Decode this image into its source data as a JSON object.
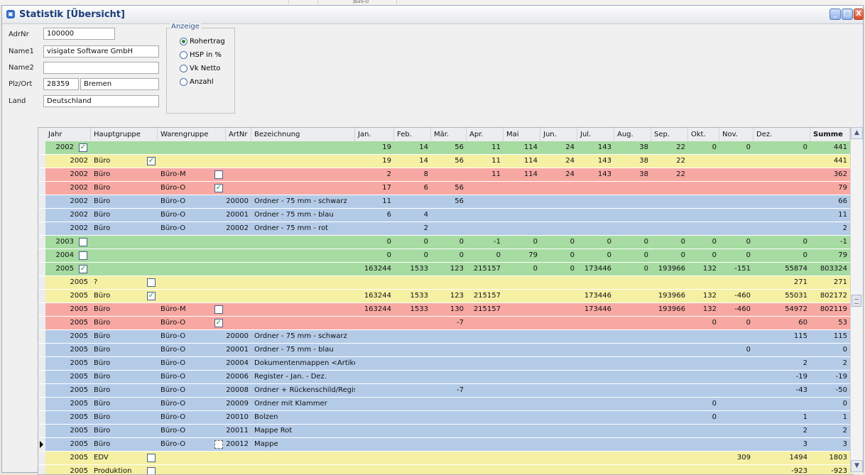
{
  "background": {
    "cell_text": "Büro-O"
  },
  "window": {
    "title": "Statistik [Übersicht]",
    "minimize": "_",
    "maximize": "□",
    "close": "X"
  },
  "form": {
    "adrnr_label": "AdrNr",
    "adrnr": "100000",
    "name1_label": "Name1",
    "name1": "visigate Software GmbH",
    "name2_label": "Name2",
    "name2": "",
    "plzort_label": "Plz/Ort",
    "plz": "28359",
    "ort": "Bremen",
    "land_label": "Land",
    "land": "Deutschland"
  },
  "anzeige": {
    "label": "Anzeige",
    "options": [
      "Rohertrag",
      "HSP in %",
      "Vk Netto",
      "Anzahl"
    ],
    "selected": 0
  },
  "colors": {
    "green": "#a6dba1",
    "yellow": "#f5f0a3",
    "red": "#f7a8a3",
    "blue": "#b4cbe8"
  },
  "table": {
    "headers": [
      "Jahr",
      "Hauptgruppe",
      "Warengruppe",
      "ArtNr",
      "Bezeichnung",
      "Jan.",
      "Feb.",
      "Mär.",
      "Apr.",
      "Mai",
      "Jun.",
      "Jul.",
      "Aug.",
      "Sep.",
      "Okt.",
      "Nov.",
      "Dez.",
      "Summe"
    ],
    "rows": [
      {
        "color": "green",
        "jahr": "2002",
        "jcb": "checked",
        "hg": "",
        "hcb": "none",
        "wg": "",
        "wcb": "none",
        "artnr": "",
        "bez": "",
        "m": [
          "19",
          "14",
          "56",
          "11",
          "114",
          "24",
          "143",
          "38",
          "22",
          "0",
          "0",
          "0"
        ],
        "summe": "441"
      },
      {
        "color": "yellow",
        "jahr": "2002",
        "jcb": "none",
        "hg": "Büro",
        "hcb": "checked",
        "wg": "",
        "wcb": "none",
        "artnr": "",
        "bez": "",
        "m": [
          "19",
          "14",
          "56",
          "11",
          "114",
          "24",
          "143",
          "38",
          "22",
          "",
          "",
          ""
        ],
        "summe": "441"
      },
      {
        "color": "red",
        "jahr": "2002",
        "jcb": "none",
        "hg": "Büro",
        "hcb": "none",
        "wg": "Büro-M",
        "wcb": "empty",
        "artnr": "",
        "bez": "",
        "m": [
          "2",
          "8",
          "",
          "11",
          "114",
          "24",
          "143",
          "38",
          "22",
          "",
          "",
          ""
        ],
        "summe": "362"
      },
      {
        "color": "red",
        "jahr": "2002",
        "jcb": "none",
        "hg": "Büro",
        "hcb": "none",
        "wg": "Büro-O",
        "wcb": "checked",
        "artnr": "",
        "bez": "",
        "m": [
          "17",
          "6",
          "56",
          "",
          "",
          "",
          "",
          "",
          "",
          "",
          "",
          ""
        ],
        "summe": "79"
      },
      {
        "color": "blue",
        "jahr": "2002",
        "jcb": "none",
        "hg": "Büro",
        "hcb": "none",
        "wg": "Büro-O",
        "wcb": "none",
        "artnr": "20000",
        "bez": "Ordner - 75 mm - schwarz",
        "m": [
          "11",
          "",
          "56",
          "",
          "",
          "",
          "",
          "",
          "",
          "",
          "",
          ""
        ],
        "summe": "66"
      },
      {
        "color": "blue",
        "jahr": "2002",
        "jcb": "none",
        "hg": "Büro",
        "hcb": "none",
        "wg": "Büro-O",
        "wcb": "none",
        "artnr": "20001",
        "bez": "Ordner - 75 mm - blau",
        "m": [
          "6",
          "4",
          "",
          "",
          "",
          "",
          "",
          "",
          "",
          "",
          "",
          ""
        ],
        "summe": "11"
      },
      {
        "color": "blue",
        "jahr": "2002",
        "jcb": "none",
        "hg": "Büro",
        "hcb": "none",
        "wg": "Büro-O",
        "wcb": "none",
        "artnr": "20002",
        "bez": "Ordner - 75 mm - rot",
        "m": [
          "",
          "2",
          "",
          "",
          "",
          "",
          "",
          "",
          "",
          "",
          "",
          ""
        ],
        "summe": "2"
      },
      {
        "color": "green",
        "jahr": "2003",
        "jcb": "empty",
        "hg": "",
        "hcb": "none",
        "wg": "",
        "wcb": "none",
        "artnr": "",
        "bez": "",
        "m": [
          "0",
          "0",
          "0",
          "-1",
          "0",
          "0",
          "0",
          "0",
          "0",
          "0",
          "0",
          "0"
        ],
        "summe": "-1"
      },
      {
        "color": "green",
        "jahr": "2004",
        "jcb": "empty",
        "hg": "",
        "hcb": "none",
        "wg": "",
        "wcb": "none",
        "artnr": "",
        "bez": "",
        "m": [
          "0",
          "0",
          "0",
          "0",
          "79",
          "0",
          "0",
          "0",
          "0",
          "0",
          "0",
          "0"
        ],
        "summe": "79"
      },
      {
        "color": "green",
        "jahr": "2005",
        "jcb": "checked",
        "hg": "",
        "hcb": "none",
        "wg": "",
        "wcb": "none",
        "artnr": "",
        "bez": "",
        "m": [
          "163244",
          "1533",
          "123",
          "215157",
          "0",
          "0",
          "173446",
          "0",
          "193966",
          "132",
          "-151",
          "55874"
        ],
        "summe": "803324"
      },
      {
        "color": "yellow",
        "jahr": "2005",
        "jcb": "none",
        "hg": "?",
        "hcb": "empty",
        "wg": "",
        "wcb": "none",
        "artnr": "",
        "bez": "",
        "m": [
          "",
          "",
          "",
          "",
          "",
          "",
          "",
          "",
          "",
          "",
          "",
          "271"
        ],
        "summe": "271"
      },
      {
        "color": "yellow",
        "jahr": "2005",
        "jcb": "none",
        "hg": "Büro",
        "hcb": "checked",
        "wg": "",
        "wcb": "none",
        "artnr": "",
        "bez": "",
        "m": [
          "163244",
          "1533",
          "123",
          "215157",
          "",
          "",
          "173446",
          "",
          "193966",
          "132",
          "-460",
          "55031"
        ],
        "summe": "802172"
      },
      {
        "color": "red",
        "jahr": "2005",
        "jcb": "none",
        "hg": "Büro",
        "hcb": "none",
        "wg": "Büro-M",
        "wcb": "empty",
        "artnr": "",
        "bez": "",
        "m": [
          "163244",
          "1533",
          "130",
          "215157",
          "",
          "",
          "173446",
          "",
          "193966",
          "132",
          "-460",
          "54972"
        ],
        "summe": "802119"
      },
      {
        "color": "red",
        "jahr": "2005",
        "jcb": "none",
        "hg": "Büro",
        "hcb": "none",
        "wg": "Büro-O",
        "wcb": "checked",
        "artnr": "",
        "bez": "",
        "m": [
          "",
          "",
          "-7",
          "",
          "",
          "",
          "",
          "",
          "",
          "0",
          "0",
          "60"
        ],
        "summe": "53"
      },
      {
        "color": "blue",
        "jahr": "2005",
        "jcb": "none",
        "hg": "Büro",
        "hcb": "none",
        "wg": "Büro-O",
        "wcb": "none",
        "artnr": "20000",
        "bez": "Ordner - 75 mm - schwarz",
        "m": [
          "",
          "",
          "",
          "",
          "",
          "",
          "",
          "",
          "",
          "",
          "",
          "115"
        ],
        "summe": "115"
      },
      {
        "color": "blue",
        "jahr": "2005",
        "jcb": "none",
        "hg": "Büro",
        "hcb": "none",
        "wg": "Büro-O",
        "wcb": "none",
        "artnr": "20001",
        "bez": "Ordner - 75 mm - blau",
        "m": [
          "",
          "",
          "",
          "",
          "",
          "",
          "",
          "",
          "",
          "",
          "0",
          ""
        ],
        "summe": "0"
      },
      {
        "color": "blue",
        "jahr": "2005",
        "jcb": "none",
        "hg": "Büro",
        "hcb": "none",
        "wg": "Büro-O",
        "wcb": "none",
        "artnr": "20004",
        "bez": "Dokumentenmappen <Artike",
        "m": [
          "",
          "",
          "",
          "",
          "",
          "",
          "",
          "",
          "",
          "",
          "",
          "2"
        ],
        "summe": "2"
      },
      {
        "color": "blue",
        "jahr": "2005",
        "jcb": "none",
        "hg": "Büro",
        "hcb": "none",
        "wg": "Büro-O",
        "wcb": "none",
        "artnr": "20006",
        "bez": "Register - Jan. - Dez.",
        "m": [
          "",
          "",
          "",
          "",
          "",
          "",
          "",
          "",
          "",
          "",
          "",
          "-19"
        ],
        "summe": "-19"
      },
      {
        "color": "blue",
        "jahr": "2005",
        "jcb": "none",
        "hg": "Büro",
        "hcb": "none",
        "wg": "Büro-O",
        "wcb": "none",
        "artnr": "20008",
        "bez": "Ordner + Rückenschild/Regis",
        "m": [
          "",
          "",
          "-7",
          "",
          "",
          "",
          "",
          "",
          "",
          "",
          "",
          "-43"
        ],
        "summe": "-50"
      },
      {
        "color": "blue",
        "jahr": "2005",
        "jcb": "none",
        "hg": "Büro",
        "hcb": "none",
        "wg": "Büro-O",
        "wcb": "none",
        "artnr": "20009",
        "bez": "Ordner mit Klammer",
        "m": [
          "",
          "",
          "",
          "",
          "",
          "",
          "",
          "",
          "",
          "0",
          "",
          ""
        ],
        "summe": "0"
      },
      {
        "color": "blue",
        "jahr": "2005",
        "jcb": "none",
        "hg": "Büro",
        "hcb": "none",
        "wg": "Büro-O",
        "wcb": "none",
        "artnr": "20010",
        "bez": "Bolzen",
        "m": [
          "",
          "",
          "",
          "",
          "",
          "",
          "",
          "",
          "",
          "0",
          "",
          "1"
        ],
        "summe": "1"
      },
      {
        "color": "blue",
        "jahr": "2005",
        "jcb": "none",
        "hg": "Büro",
        "hcb": "none",
        "wg": "Büro-O",
        "wcb": "none",
        "artnr": "20011",
        "bez": "Mappe Rot",
        "m": [
          "",
          "",
          "",
          "",
          "",
          "",
          "",
          "",
          "",
          "",
          "",
          "2"
        ],
        "summe": "2"
      },
      {
        "color": "blue",
        "jahr": "2005",
        "jcb": "none",
        "hg": "Büro",
        "hcb": "none",
        "wg": "Büro-O",
        "wcb": "dashed",
        "artnr": "20012",
        "bez": "Mappe",
        "m": [
          "",
          "",
          "",
          "",
          "",
          "",
          "",
          "",
          "",
          "",
          "",
          "3"
        ],
        "summe": "3",
        "current": true
      },
      {
        "color": "yellow",
        "jahr": "2005",
        "jcb": "none",
        "hg": "EDV",
        "hcb": "empty",
        "wg": "",
        "wcb": "none",
        "artnr": "",
        "bez": "",
        "m": [
          "",
          "",
          "",
          "",
          "",
          "",
          "",
          "",
          "",
          "",
          "309",
          "1494"
        ],
        "summe": "1803"
      },
      {
        "color": "yellow",
        "jahr": "2005",
        "jcb": "none",
        "hg": "Produktion",
        "hcb": "empty",
        "wg": "",
        "wcb": "none",
        "artnr": "",
        "bez": "",
        "m": [
          "",
          "",
          "",
          "",
          "",
          "",
          "",
          "",
          "",
          "",
          "",
          "-923"
        ],
        "summe": "-923"
      }
    ]
  },
  "scrollbar": {
    "up_icon": "▲",
    "down_icon": "▼"
  }
}
